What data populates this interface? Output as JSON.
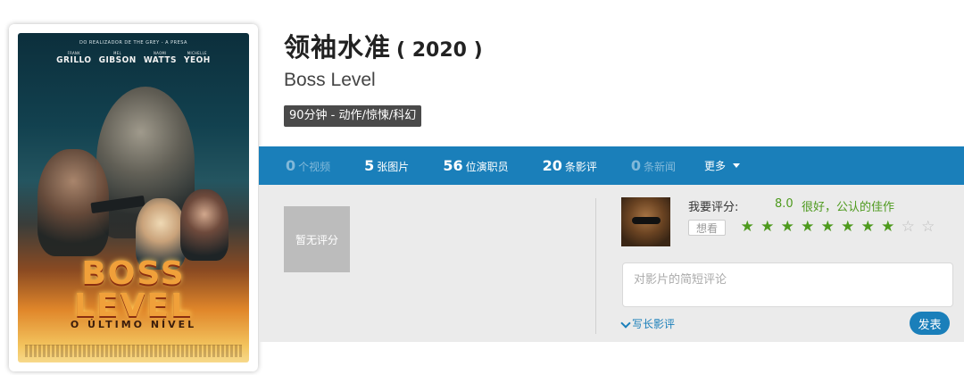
{
  "movie": {
    "title_cn": "领袖水准",
    "year": "( 2020 )",
    "title_en": "Boss Level",
    "meta": "90分钟 - 动作/惊悚/科幻"
  },
  "poster": {
    "tagline": "DO REALIZADOR DE THE GREY - A PRESA",
    "cast": [
      {
        "first": "FRANK",
        "last": "GRILLO"
      },
      {
        "first": "MEL",
        "last": "GIBSON"
      },
      {
        "first": "NAOMI",
        "last": "WATTS"
      },
      {
        "first": "MICHELLE",
        "last": "YEOH"
      }
    ],
    "title": "BOSS LEVEL",
    "subtitle": "O ÚLTIMO NÍVEL"
  },
  "stats": [
    {
      "num": "0",
      "label": "个视频",
      "active": false
    },
    {
      "num": "5",
      "label": "张图片",
      "active": true
    },
    {
      "num": "56",
      "label": "位演职员",
      "active": true
    },
    {
      "num": "20",
      "label": "条影评",
      "active": true
    },
    {
      "num": "0",
      "label": "条新闻",
      "active": false
    }
  ],
  "more_label": "更多",
  "no_rating_label": "暂无评分",
  "rating": {
    "label": "我要评分:",
    "score": "8.0",
    "text": "很好，公认的佳作",
    "stars_filled": 8,
    "stars_total": 10
  },
  "want_label": "想看",
  "comment": {
    "placeholder": "对影片的简短评论"
  },
  "long_review_label": "写长影评",
  "post_label": "发表",
  "colors": {
    "accent": "#1a7fba",
    "rating_green": "#4e9a1e",
    "panel": "#ebebeb"
  }
}
